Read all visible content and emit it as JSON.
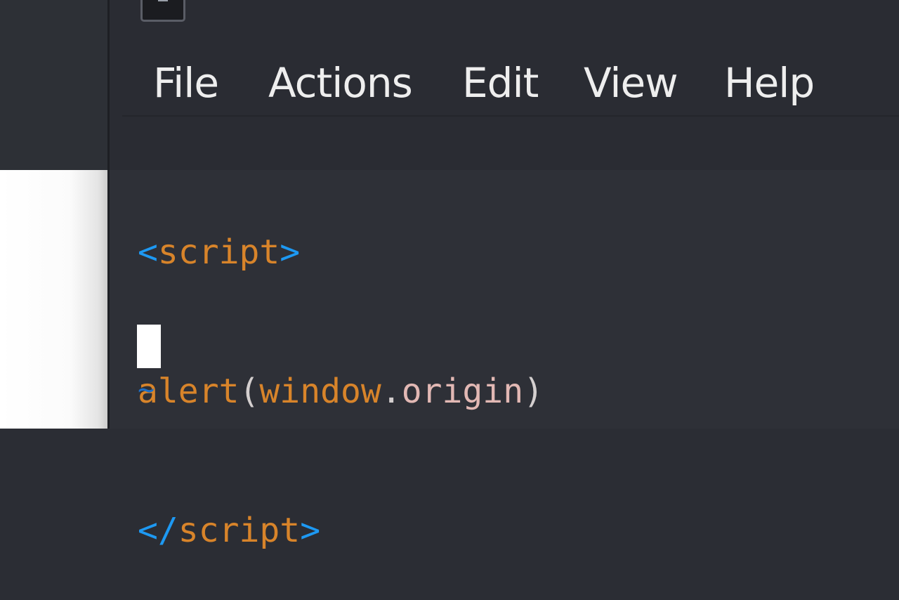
{
  "menubar": {
    "items": [
      {
        "label": "File"
      },
      {
        "label": "Actions"
      },
      {
        "label": "Edit"
      },
      {
        "label": "View"
      },
      {
        "label": "Help"
      }
    ]
  },
  "editor": {
    "lines": [
      {
        "open": "<",
        "name": "script",
        "close": ">"
      },
      {
        "fn": "alert",
        "paren_open": "(",
        "obj": "window",
        "dot": ".",
        "prop": "origin",
        "paren_close": ")"
      },
      {
        "open": "</",
        "name": "script",
        "close": ">"
      }
    ],
    "empty_line_marker": "~"
  },
  "colors": {
    "tag": "#1d99f3",
    "identifier": "#d8842a",
    "property": "#e2b8b4",
    "background": "#2a2c33",
    "cursor": "#ffffff"
  },
  "icons": {
    "app": "terminal-icon"
  }
}
